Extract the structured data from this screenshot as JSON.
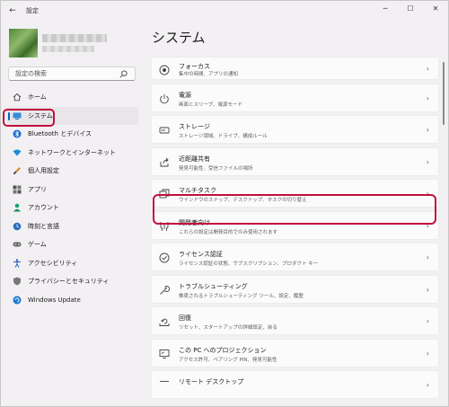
{
  "titlebar": {
    "back_icon": "back-arrow-icon",
    "title": "設定",
    "minimize_icon": "minimize-icon",
    "maximize_icon": "maximize-icon",
    "close_icon": "close-icon"
  },
  "search": {
    "placeholder": "設定の検索",
    "icon": "search-icon"
  },
  "sidebar": {
    "items": [
      {
        "label": "ホーム",
        "icon": "home-icon",
        "active": false
      },
      {
        "label": "システム",
        "icon": "monitor-icon",
        "active": true
      },
      {
        "label": "Bluetooth とデバイス",
        "icon": "bluetooth-icon",
        "active": false
      },
      {
        "label": "ネットワークとインターネット",
        "icon": "wifi-icon",
        "active": false
      },
      {
        "label": "個人用設定",
        "icon": "brush-icon",
        "active": false
      },
      {
        "label": "アプリ",
        "icon": "apps-icon",
        "active": false
      },
      {
        "label": "アカウント",
        "icon": "account-icon",
        "active": false
      },
      {
        "label": "時刻と言語",
        "icon": "clock-language-icon",
        "active": false
      },
      {
        "label": "ゲーム",
        "icon": "gamepad-icon",
        "active": false
      },
      {
        "label": "アクセシビリティ",
        "icon": "accessibility-icon",
        "active": false
      },
      {
        "label": "プライバシーとセキュリティ",
        "icon": "shield-icon",
        "active": false
      },
      {
        "label": "Windows Update",
        "icon": "windows-update-icon",
        "active": false
      }
    ]
  },
  "main": {
    "title": "システム",
    "items": [
      {
        "title": "フォーカス",
        "subtitle": "集中の時間、アプリの通知",
        "icon": "focus-icon"
      },
      {
        "title": "電源",
        "subtitle": "画面とスリープ、電源モード",
        "icon": "power-icon"
      },
      {
        "title": "ストレージ",
        "subtitle": "ストレージ領域、ドライブ、構成ルール",
        "icon": "storage-icon"
      },
      {
        "title": "近距離共有",
        "subtitle": "発見可能性、受信ファイルの場所",
        "icon": "share-icon"
      },
      {
        "title": "マルチタスク",
        "subtitle": "ウインドウのスナップ、デスクトップ、タスクの切り替え",
        "icon": "multitask-icon"
      },
      {
        "title": "開発者向け",
        "subtitle": "これらの設定は開発目的でのみ使用されます",
        "icon": "developer-icon"
      },
      {
        "title": "ライセンス認証",
        "subtitle": "ライセンス認証の状態、サブスクリプション、プロダクト キー",
        "icon": "activation-icon"
      },
      {
        "title": "トラブルシューティング",
        "subtitle": "推奨されるトラブルシューティング ツール、設定、履歴",
        "icon": "wrench-icon"
      },
      {
        "title": "回復",
        "subtitle": "リセット、スタートアップの詳細設定、戻る",
        "icon": "recovery-icon"
      },
      {
        "title": "この PC へのプロジェクション",
        "subtitle": "アクセス許可、ペアリング PIN、発見可能性",
        "icon": "projection-icon"
      },
      {
        "title": "リモート デスクトップ",
        "subtitle": "",
        "icon": "remote-desktop-icon"
      }
    ]
  },
  "colors": {
    "accent": "#0067c0",
    "highlight": "#c0103c"
  }
}
